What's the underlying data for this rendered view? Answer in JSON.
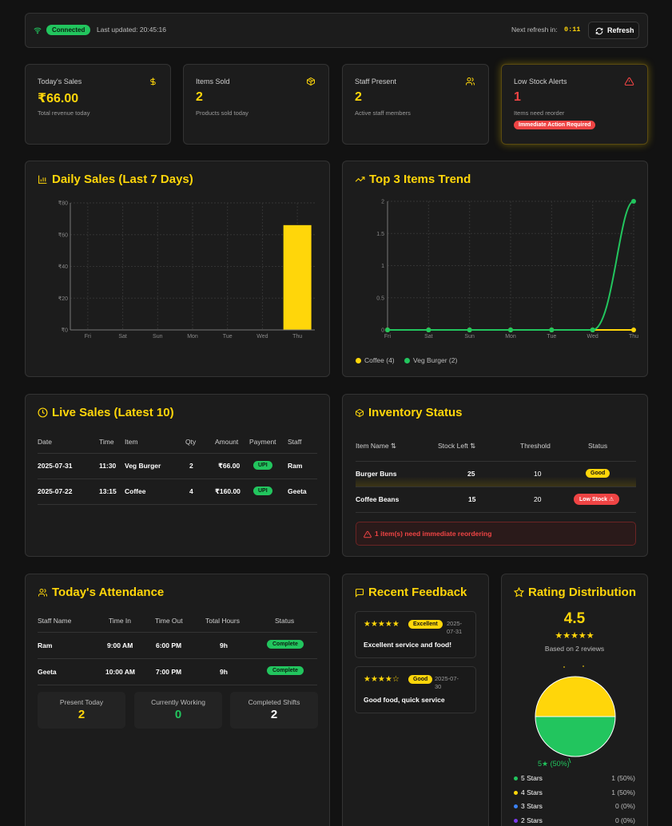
{
  "topbar": {
    "status": "Connected",
    "last_updated": "Last updated: 20:45:16",
    "next_refresh_label": "Next refresh in:",
    "next_refresh_value": "0:11",
    "refresh_button": "Refresh"
  },
  "stats": [
    {
      "label": "Today's Sales",
      "value": "₹66.00",
      "sub": "Total revenue today",
      "icon": "dollar-icon"
    },
    {
      "label": "Items Sold",
      "value": "2",
      "sub": "Products sold today",
      "icon": "box-icon"
    },
    {
      "label": "Staff Present",
      "value": "2",
      "sub": "Active staff members",
      "icon": "users-icon"
    },
    {
      "label": "Low Stock Alerts",
      "value": "1",
      "sub": "Items need reorder",
      "badge": "Immediate Action Required",
      "icon": "alert-triangle-icon"
    }
  ],
  "daily_sales": {
    "title": "Daily Sales (Last 7 Days)"
  },
  "top_items": {
    "title": "Top 3 Items Trend"
  },
  "chart_data": [
    {
      "type": "bar",
      "categories": [
        "Fri",
        "Sat",
        "Sun",
        "Mon",
        "Tue",
        "Wed",
        "Thu"
      ],
      "values": [
        0,
        0,
        0,
        0,
        0,
        0,
        66
      ],
      "ylim": [
        0,
        80
      ],
      "yticks": [
        "₹0",
        "₹20",
        "₹40",
        "₹60",
        "₹80"
      ],
      "grid": true,
      "colors": [
        "#ffd60a"
      ]
    },
    {
      "type": "line",
      "categories": [
        "Fri",
        "Sat",
        "Sun",
        "Mon",
        "Tue",
        "Wed",
        "Thu"
      ],
      "series": [
        {
          "name": "Coffee (4)",
          "values": [
            0,
            0,
            0,
            0,
            0,
            0,
            0
          ],
          "color": "#ffd60a"
        },
        {
          "name": "Veg Burger (2)",
          "values": [
            0,
            0,
            0,
            0,
            0,
            0,
            2
          ],
          "color": "#22c55e"
        }
      ],
      "ylim": [
        0,
        2
      ],
      "yticks": [
        "0",
        "0.5",
        "1",
        "1.5",
        "2"
      ],
      "grid": true,
      "legend": "bottom-left"
    },
    {
      "type": "pie",
      "categories": [
        "5 Stars",
        "4 Stars"
      ],
      "values": [
        1,
        1
      ],
      "colors": [
        "#22c55e",
        "#ffd60a"
      ],
      "labels": [
        "5★ (50%)"
      ]
    }
  ],
  "live_sales": {
    "title": "Live Sales (Latest 10)",
    "headers": [
      "Date",
      "Time",
      "Item",
      "Qty",
      "Amount",
      "Payment",
      "Staff"
    ],
    "rows": [
      {
        "date": "2025-07-31",
        "time": "11:30",
        "item": "Veg Burger",
        "qty": "2",
        "amount": "₹66.00",
        "payment": "UPI",
        "staff": "Ram"
      },
      {
        "date": "2025-07-22",
        "time": "13:15",
        "item": "Coffee",
        "qty": "4",
        "amount": "₹160.00",
        "payment": "UPI",
        "staff": "Geeta"
      }
    ]
  },
  "inventory": {
    "title": "Inventory Status",
    "headers": [
      "Item Name ⇅",
      "Stock Left ⇅",
      "Threshold",
      "Status"
    ],
    "rows": [
      {
        "name": "Burger Buns",
        "stock": "25",
        "threshold": "10",
        "status": "Good"
      },
      {
        "name": "Coffee Beans",
        "stock": "15",
        "threshold": "20",
        "status": "Low Stock ⚠"
      }
    ],
    "alert": "1 item(s) need immediate reordering"
  },
  "attendance": {
    "title": "Today's Attendance",
    "headers": [
      "Staff Name",
      "Time In",
      "Time Out",
      "Total Hours",
      "Status"
    ],
    "rows": [
      {
        "name": "Ram",
        "in": "9:00 AM",
        "out": "6:00 PM",
        "hours": "9h",
        "status": "Complete"
      },
      {
        "name": "Geeta",
        "in": "10:00 AM",
        "out": "7:00 PM",
        "hours": "9h",
        "status": "Complete"
      }
    ],
    "summary": [
      {
        "label": "Present Today",
        "value": "2"
      },
      {
        "label": "Currently Working",
        "value": "0"
      },
      {
        "label": "Completed Shifts",
        "value": "2"
      }
    ]
  },
  "feedback": {
    "title": "Recent Feedback",
    "items": [
      {
        "stars": "★★★★★",
        "tag": "Excellent",
        "date1": "2025-",
        "date2": "07-31",
        "text": "Excellent service and food!"
      },
      {
        "stars": "★★★★☆",
        "tag": "Good",
        "date1": "2025-07-",
        "date2": "30",
        "text": "Good food, quick service"
      }
    ]
  },
  "rating": {
    "title": "Rating Distribution",
    "average": "4.5",
    "stars": "★★★★★",
    "based_on": "Based on 2 reviews",
    "legend": [
      {
        "label": "5 Stars",
        "count": "1 (50%)",
        "color": "#22c55e"
      },
      {
        "label": "4 Stars",
        "count": "1 (50%)",
        "color": "#ffd60a"
      },
      {
        "label": "3 Stars",
        "count": "0 (0%)",
        "color": "#3b82f6"
      },
      {
        "label": "2 Stars",
        "count": "0 (0%)",
        "color": "#7c3aed"
      }
    ]
  }
}
